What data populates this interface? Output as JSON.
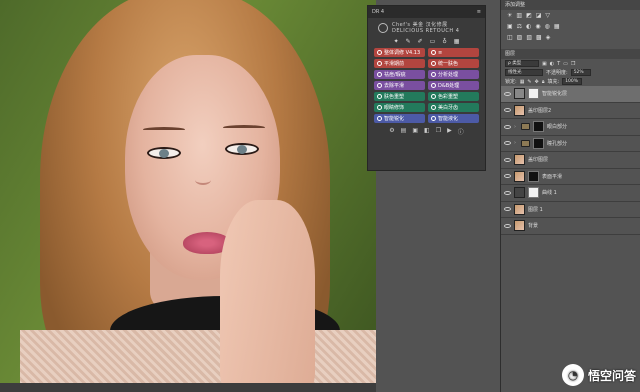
{
  "dr_panel": {
    "tab_label": "DR 4",
    "brand_line1": "Chef's 美金 汉化修展",
    "brand_line2": "DELICIOUS RETOUCH 4",
    "buttons": [
      {
        "label": "整体调修 V4.13",
        "color": "#b2453f"
      },
      {
        "label": "≡",
        "color": "#b2453f"
      },
      {
        "label": "平滑期前",
        "color": "#b2453f"
      },
      {
        "label": "统一肤色",
        "color": "#b2453f"
      },
      {
        "label": "祛痘/瑕疵",
        "color": "#7a4fa0"
      },
      {
        "label": "分析处理",
        "color": "#7a4fa0"
      },
      {
        "label": "去除平滑",
        "color": "#7a4fa0"
      },
      {
        "label": "D&B处理",
        "color": "#7a4fa0"
      },
      {
        "label": "肤色重塑",
        "color": "#237a5c"
      },
      {
        "label": "色彩重塑",
        "color": "#237a5c"
      },
      {
        "label": "眼睛修饰",
        "color": "#237a5c"
      },
      {
        "label": "美白牙齿",
        "color": "#237a5c"
      },
      {
        "label": "智能锐化",
        "color": "#4c5aa6"
      },
      {
        "label": "智能液化",
        "color": "#4c5aa6"
      }
    ]
  },
  "adjustments": {
    "title": "添加调整"
  },
  "layers": {
    "title": "图层",
    "filter_kind": "ρ 类型",
    "blend_mode": "线性光",
    "opacity_label": "不透明度:",
    "opacity_value": "52%",
    "lock_label": "锁定:",
    "fill_label": "填充:",
    "fill_value": "100%",
    "items": [
      {
        "name": "智能锐化层",
        "type": "smart",
        "selected": true
      },
      {
        "name": "盖印图层2",
        "type": "photo"
      },
      {
        "name": "眼白部分",
        "type": "folder-mask"
      },
      {
        "name": "瞳孔部分",
        "type": "folder-mask"
      },
      {
        "name": "盖印图层",
        "type": "photo"
      },
      {
        "name": "表面平滑",
        "type": "photo-mask"
      },
      {
        "name": "曲线 1",
        "type": "adjust-mask"
      },
      {
        "name": "图层 1",
        "type": "photo"
      },
      {
        "name": "背景",
        "type": "photo"
      }
    ]
  },
  "watermark": {
    "text": "悟空问答"
  }
}
